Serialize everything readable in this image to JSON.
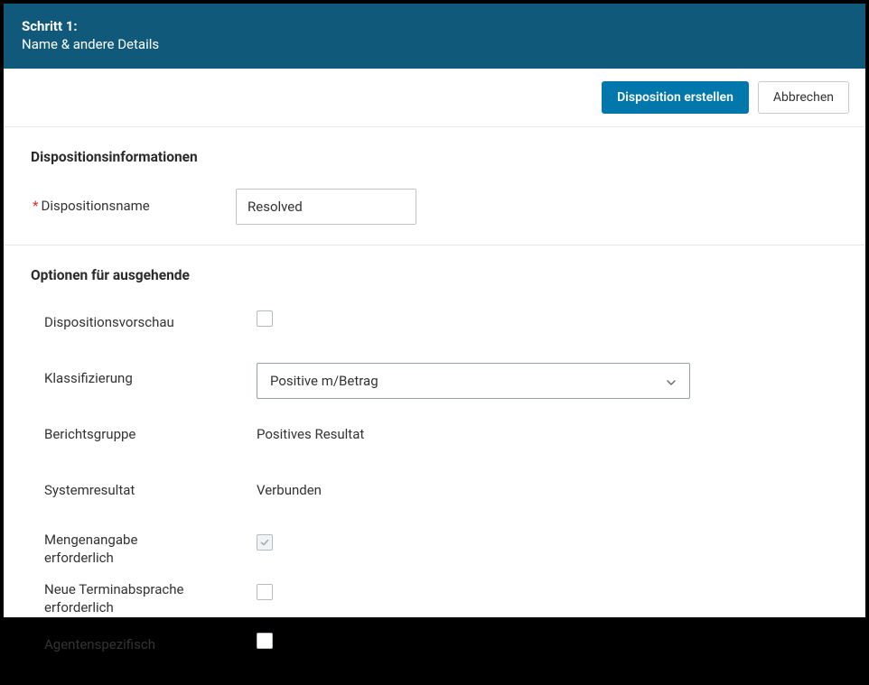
{
  "header": {
    "step": "Schritt 1:",
    "subtitle": "Name & andere Details"
  },
  "actions": {
    "primary": "Disposition erstellen",
    "cancel": "Abbrechen"
  },
  "section1": {
    "title": "Dispositionsinformationen",
    "dispositionsname_label": "Dispositionsname",
    "dispositionsname_value": "Resolved"
  },
  "section2": {
    "title": "Optionen für ausgehende",
    "rows": {
      "vorschau_label": "Dispositionsvorschau",
      "klassifizierung_label": "Klassifizierung",
      "klassifizierung_value": "Positive m/Betrag",
      "berichtsgruppe_label": "Berichtsgruppe",
      "berichtsgruppe_value": "Positives Resultat",
      "systemresultat_label": "Systemresultat",
      "systemresultat_value": "Verbunden",
      "mengenangabe_label": "Mengenangabe erforderlich",
      "terminabsprache_label": "Neue Terminabsprache erforderlich",
      "agentenspezifisch_label": "Agentenspezifisch"
    }
  }
}
